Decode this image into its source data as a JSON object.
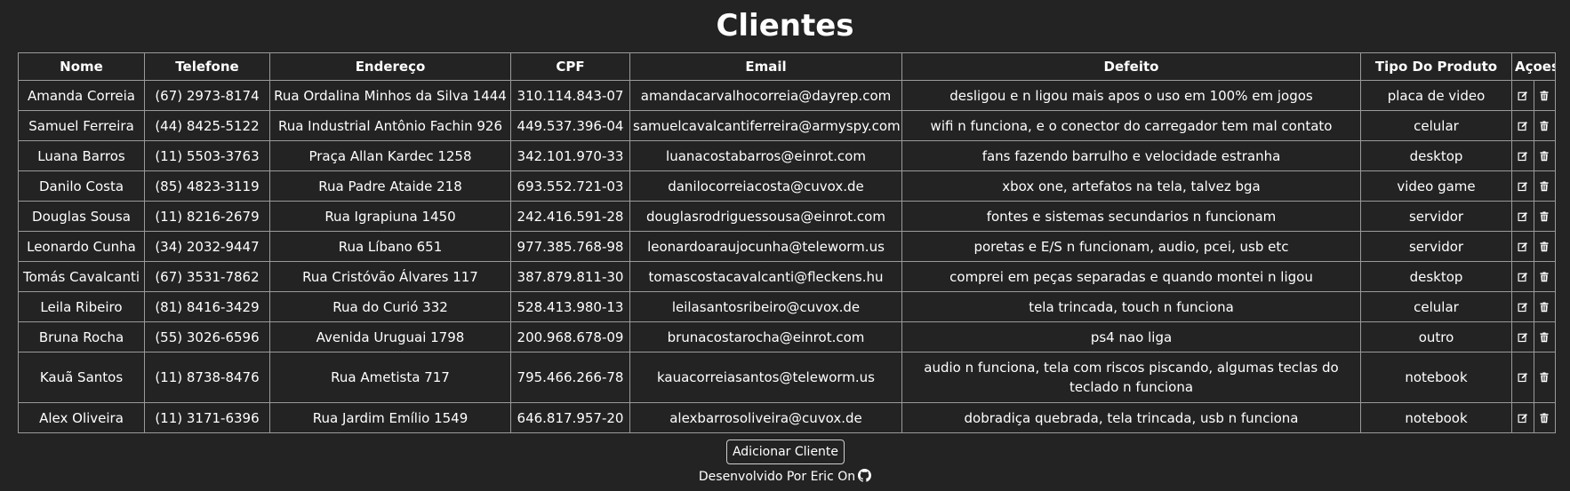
{
  "page": {
    "title": "Clientes"
  },
  "table": {
    "headers": [
      "Nome",
      "Telefone",
      "Endereço",
      "CPF",
      "Email",
      "Defeito",
      "Tipo Do Produto",
      "Açoes"
    ],
    "rows": [
      {
        "nome": "Amanda Correia",
        "telefone": "(67) 2973-8174",
        "endereco": "Rua Ordalina Minhos da Silva 1444",
        "cpf": "310.114.843-07",
        "email": "amandacarvalhocorreia@dayrep.com",
        "defeito": "desligou e n ligou mais apos o uso em 100% em jogos",
        "tipo": "placa de video"
      },
      {
        "nome": "Samuel Ferreira",
        "telefone": "(44) 8425-5122",
        "endereco": "Rua Industrial Antônio Fachin 926",
        "cpf": "449.537.396-04",
        "email": "samuelcavalcantiferreira@armyspy.com",
        "defeito": "wifi n funciona, e o conector do carregador tem mal contato",
        "tipo": "celular"
      },
      {
        "nome": "Luana Barros",
        "telefone": "(11) 5503-3763",
        "endereco": "Praça Allan Kardec 1258",
        "cpf": "342.101.970-33",
        "email": "luanacostabarros@einrot.com",
        "defeito": "fans fazendo barrulho e velocidade estranha",
        "tipo": "desktop"
      },
      {
        "nome": "Danilo Costa",
        "telefone": "(85) 4823-3119",
        "endereco": "Rua Padre Ataide 218",
        "cpf": "693.552.721-03",
        "email": "danilocorreiacosta@cuvox.de",
        "defeito": "xbox one, artefatos na tela, talvez bga",
        "tipo": "video game"
      },
      {
        "nome": "Douglas Sousa",
        "telefone": "(11) 8216-2679",
        "endereco": "Rua Igrapiuna 1450",
        "cpf": "242.416.591-28",
        "email": "douglasrodriguessousa@einrot.com",
        "defeito": "fontes e sistemas secundarios n funcionam",
        "tipo": "servidor"
      },
      {
        "nome": "Leonardo Cunha",
        "telefone": "(34) 2032-9447",
        "endereco": "Rua Líbano 651",
        "cpf": "977.385.768-98",
        "email": "leonardoaraujocunha@teleworm.us",
        "defeito": "poretas e E/S n funcionam, audio, pcei, usb etc",
        "tipo": "servidor"
      },
      {
        "nome": "Tomás Cavalcanti",
        "telefone": "(67) 3531-7862",
        "endereco": "Rua Cristóvão Álvares 117",
        "cpf": "387.879.811-30",
        "email": "tomascostacavalcanti@fleckens.hu",
        "defeito": "comprei em peças separadas e quando montei n ligou",
        "tipo": "desktop"
      },
      {
        "nome": "Leila Ribeiro",
        "telefone": "(81) 8416-3429",
        "endereco": "Rua do Curió 332",
        "cpf": "528.413.980-13",
        "email": "leilasantosribeiro@cuvox.de",
        "defeito": "tela trincada, touch n funciona",
        "tipo": "celular"
      },
      {
        "nome": "Bruna Rocha",
        "telefone": "(55) 3026-6596",
        "endereco": "Avenida Uruguai 1798",
        "cpf": "200.968.678-09",
        "email": "brunacostarocha@einrot.com",
        "defeito": "ps4 nao liga",
        "tipo": "outro"
      },
      {
        "nome": "Kauã Santos",
        "telefone": "(11) 8738-8476",
        "endereco": "Rua Ametista 717",
        "cpf": "795.466.266-78",
        "email": "kauacorreiasantos@teleworm.us",
        "defeito": "audio n funciona, tela com riscos piscando, algumas teclas do teclado n funciona",
        "tipo": "notebook"
      },
      {
        "nome": "Alex Oliveira",
        "telefone": "(11) 3171-6396",
        "endereco": "Rua Jardim Emílio 1549",
        "cpf": "646.817.957-20",
        "email": "alexbarrosoliveira@cuvox.de",
        "defeito": "dobradiça quebrada, tela trincada, usb n funciona",
        "tipo": "notebook"
      }
    ]
  },
  "actions": {
    "add_client_label": "Adicionar Cliente"
  },
  "footer": {
    "text": "Desenvolvido Por Eric On",
    "icon": "github-icon"
  },
  "icons": {
    "edit": "edit-icon",
    "delete": "trash-icon"
  },
  "colors": {
    "background": "#232323",
    "text": "#ffffff",
    "border": "#9a9a9a"
  }
}
